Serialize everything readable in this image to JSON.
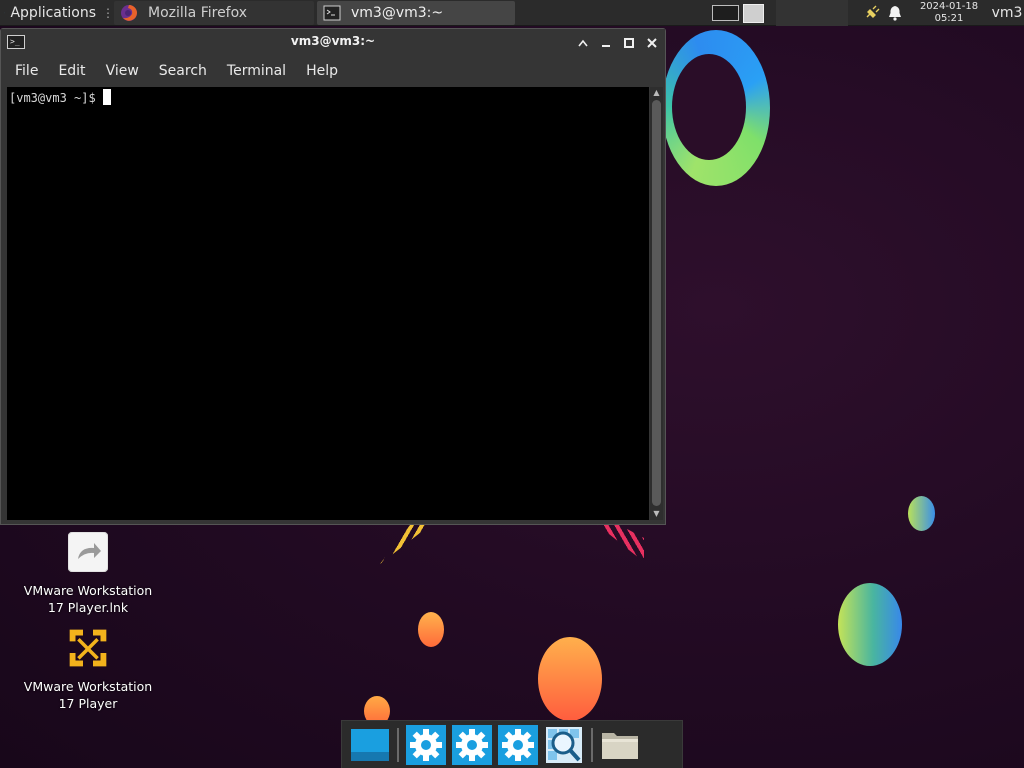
{
  "panel": {
    "applications_label": "Applications",
    "menu_separator": "⋮",
    "tasks": [
      {
        "label": "Mozilla Firefox",
        "icon": "firefox-icon"
      },
      {
        "label": "vm3@vm3:~",
        "icon": "terminal-icon"
      }
    ],
    "clock": {
      "date": "2024-01-18",
      "time": "05:21"
    },
    "user": "vm3"
  },
  "window": {
    "title": "vm3@vm3:~",
    "buttons": [
      "pin-icon",
      "minimize-icon",
      "maximize-icon",
      "close-icon"
    ],
    "menu": [
      "File",
      "Edit",
      "View",
      "Search",
      "Terminal",
      "Help"
    ],
    "prompt": "[vm3@vm3 ~]$"
  },
  "desktop": {
    "icons": [
      {
        "line1": "VMware Workstation",
        "line2": "17 Player.lnk"
      },
      {
        "line1": "VMware Workstation",
        "line2": "17 Player"
      }
    ]
  },
  "dock": {
    "items": [
      "show-desktop-icon",
      "settings-icon",
      "settings-icon",
      "settings-icon",
      "app-finder-icon",
      "file-manager-icon"
    ]
  },
  "colors": {
    "panel": "#2b2b2b",
    "window": "#353535",
    "terminal_bg": "#000000",
    "accent_blue": "#1a9fe0"
  }
}
